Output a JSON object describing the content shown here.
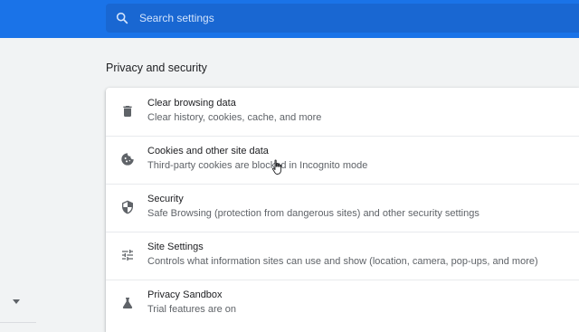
{
  "search": {
    "placeholder": "Search settings"
  },
  "section": {
    "title": "Privacy and security"
  },
  "rows": [
    {
      "icon": "trash-icon",
      "title": "Clear browsing data",
      "subtitle": "Clear history, cookies, cache, and more"
    },
    {
      "icon": "cookie-icon",
      "title": "Cookies and other site data",
      "subtitle": "Third-party cookies are blocked in Incognito mode"
    },
    {
      "icon": "shield-icon",
      "title": "Security",
      "subtitle": "Safe Browsing (protection from dangerous sites) and other security settings"
    },
    {
      "icon": "tune-icon",
      "title": "Site Settings",
      "subtitle": "Controls what information sites can use and show (location, camera, pop-ups, and more)"
    },
    {
      "icon": "flask-icon",
      "title": "Privacy Sandbox",
      "subtitle": "Trial features are on"
    }
  ],
  "colors": {
    "accent": "#1a73e8",
    "search_bg": "#1967d2",
    "page_bg": "#f1f3f4"
  }
}
